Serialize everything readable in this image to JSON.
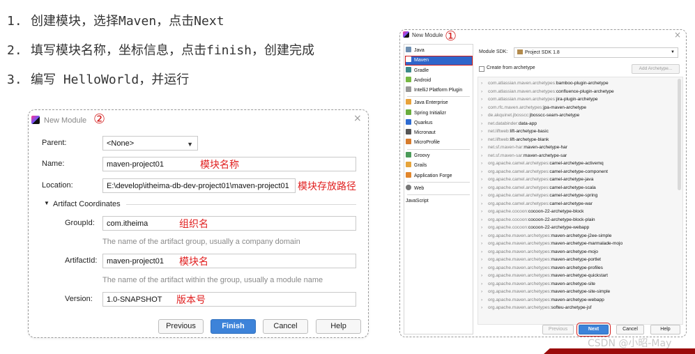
{
  "steps": [
    {
      "num": "1.",
      "text": "创建模块，选择Maven，点击Next"
    },
    {
      "num": "2.",
      "text": "填写模块名称，坐标信息，点击finish，创建完成"
    },
    {
      "num": "3.",
      "text": "编写 HelloWorld，并运行"
    }
  ],
  "form_dialog": {
    "title": "New Module",
    "marker": "②",
    "close": "×",
    "parent": {
      "label": "Parent:",
      "value": "<None>"
    },
    "name": {
      "label": "Name:",
      "value": "maven-project01",
      "note": "模块名称"
    },
    "location": {
      "label": "Location:",
      "value": "E:\\develop\\itheima-db-dev-project01\\maven-project01",
      "note": "模块存放路径"
    },
    "section": "Artifact Coordinates",
    "groupid": {
      "label": "GroupId:",
      "value": "com.itheima",
      "note": "组织名",
      "hint": "The name of the artifact group, usually a company domain"
    },
    "artifactid": {
      "label": "ArtifactId:",
      "value": "maven-project01",
      "note": "模块名",
      "hint": "The name of the artifact within the group, usually a module name"
    },
    "version": {
      "label": "Version:",
      "value": "1.0-SNAPSHOT",
      "note": "版本号"
    },
    "buttons": {
      "previous": "Previous",
      "finish": "Finish",
      "cancel": "Cancel",
      "help": "Help"
    }
  },
  "maven_dialog": {
    "title": "New Module",
    "marker": "①",
    "close": "×",
    "sidebar": [
      {
        "label": "Java",
        "icon": "folder-icon",
        "color": "#6f8fb0"
      },
      {
        "label": "Maven",
        "icon": "maven-icon",
        "color": "#c0392b",
        "selected": true
      },
      {
        "label": "Gradle",
        "icon": "gradle-icon",
        "color": "#3c8a8a"
      },
      {
        "label": "Android",
        "icon": "android-icon",
        "color": "#77b843"
      },
      {
        "label": "IntelliJ Platform Plugin",
        "icon": "plugin-icon",
        "color": "#999999"
      },
      {
        "label": "Java Enterprise",
        "icon": "enterprise-icon",
        "color": "#e8a23a"
      },
      {
        "label": "Spring Initializr",
        "icon": "spring-icon",
        "color": "#6aad3d"
      },
      {
        "label": "Quarkus",
        "icon": "quarkus-icon",
        "color": "#2d6bd1"
      },
      {
        "label": "Micronaut",
        "icon": "micronaut-icon",
        "color": "#555555"
      },
      {
        "label": "MicroProfile",
        "icon": "microprofile-icon",
        "color": "#d67b2c"
      },
      {
        "label": "Groovy",
        "icon": "groovy-icon",
        "color": "#4a9a58"
      },
      {
        "label": "Grails",
        "icon": "grails-icon",
        "color": "#e6a43a"
      },
      {
        "label": "Application Forge",
        "icon": "forge-icon",
        "color": "#e2862b"
      },
      {
        "label": "Web",
        "icon": "web-icon",
        "color": "#777777"
      },
      {
        "label": "JavaScript",
        "icon": "",
        "color": ""
      }
    ],
    "sdk_label": "Module SDK:",
    "sdk_value": "Project SDK 1.8",
    "create_from_archetype": "Create from archetype",
    "add_archetype": "Add Archetype...",
    "archetypes": [
      {
        "group": "com.atlassian.maven.archetypes:",
        "artifact": "bamboo-plugin-archetype"
      },
      {
        "group": "com.atlassian.maven.archetypes:",
        "artifact": "confluence-plugin-archetype"
      },
      {
        "group": "com.atlassian.maven.archetypes:",
        "artifact": "jira-plugin-archetype"
      },
      {
        "group": "com.rfc.maven.archetypes:",
        "artifact": "jpa-maven-archetype"
      },
      {
        "group": "de.akquinet.jbosscc:",
        "artifact": "jbosscc-seam-archetype"
      },
      {
        "group": "net.databinder:",
        "artifact": "data-app"
      },
      {
        "group": "net.liftweb:",
        "artifact": "lift-archetype-basic"
      },
      {
        "group": "net.liftweb:",
        "artifact": "lift-archetype-blank"
      },
      {
        "group": "net.sf.maven-har:",
        "artifact": "maven-archetype-har"
      },
      {
        "group": "net.sf.maven-sar:",
        "artifact": "maven-archetype-sar"
      },
      {
        "group": "org.apache.camel.archetypes:",
        "artifact": "camel-archetype-activemq"
      },
      {
        "group": "org.apache.camel.archetypes:",
        "artifact": "camel-archetype-component"
      },
      {
        "group": "org.apache.camel.archetypes:",
        "artifact": "camel-archetype-java"
      },
      {
        "group": "org.apache.camel.archetypes:",
        "artifact": "camel-archetype-scala"
      },
      {
        "group": "org.apache.camel.archetypes:",
        "artifact": "camel-archetype-spring"
      },
      {
        "group": "org.apache.camel.archetypes:",
        "artifact": "camel-archetype-war"
      },
      {
        "group": "org.apache.cocoon:",
        "artifact": "cocoon-22-archetype-block"
      },
      {
        "group": "org.apache.cocoon:",
        "artifact": "cocoon-22-archetype-block-plain"
      },
      {
        "group": "org.apache.cocoon:",
        "artifact": "cocoon-22-archetype-webapp"
      },
      {
        "group": "org.apache.maven.archetypes:",
        "artifact": "maven-archetype-j2ee-simple"
      },
      {
        "group": "org.apache.maven.archetypes:",
        "artifact": "maven-archetype-marmalade-mojo"
      },
      {
        "group": "org.apache.maven.archetypes:",
        "artifact": "maven-archetype-mojo"
      },
      {
        "group": "org.apache.maven.archetypes:",
        "artifact": "maven-archetype-portlet"
      },
      {
        "group": "org.apache.maven.archetypes:",
        "artifact": "maven-archetype-profiles"
      },
      {
        "group": "org.apache.maven.archetypes:",
        "artifact": "maven-archetype-quickstart"
      },
      {
        "group": "org.apache.maven.archetypes:",
        "artifact": "maven-archetype-site"
      },
      {
        "group": "org.apache.maven.archetypes:",
        "artifact": "maven-archetype-site-simple"
      },
      {
        "group": "org.apache.maven.archetypes:",
        "artifact": "maven-archetype-webapp"
      },
      {
        "group": "org.apache.maven.archetypes:",
        "artifact": "softeu-archetype-jsf"
      }
    ],
    "buttons": {
      "previous": "Previous",
      "next": "Next",
      "cancel": "Cancel",
      "help": "Help"
    }
  },
  "watermark": "CSDN @小昭-May"
}
